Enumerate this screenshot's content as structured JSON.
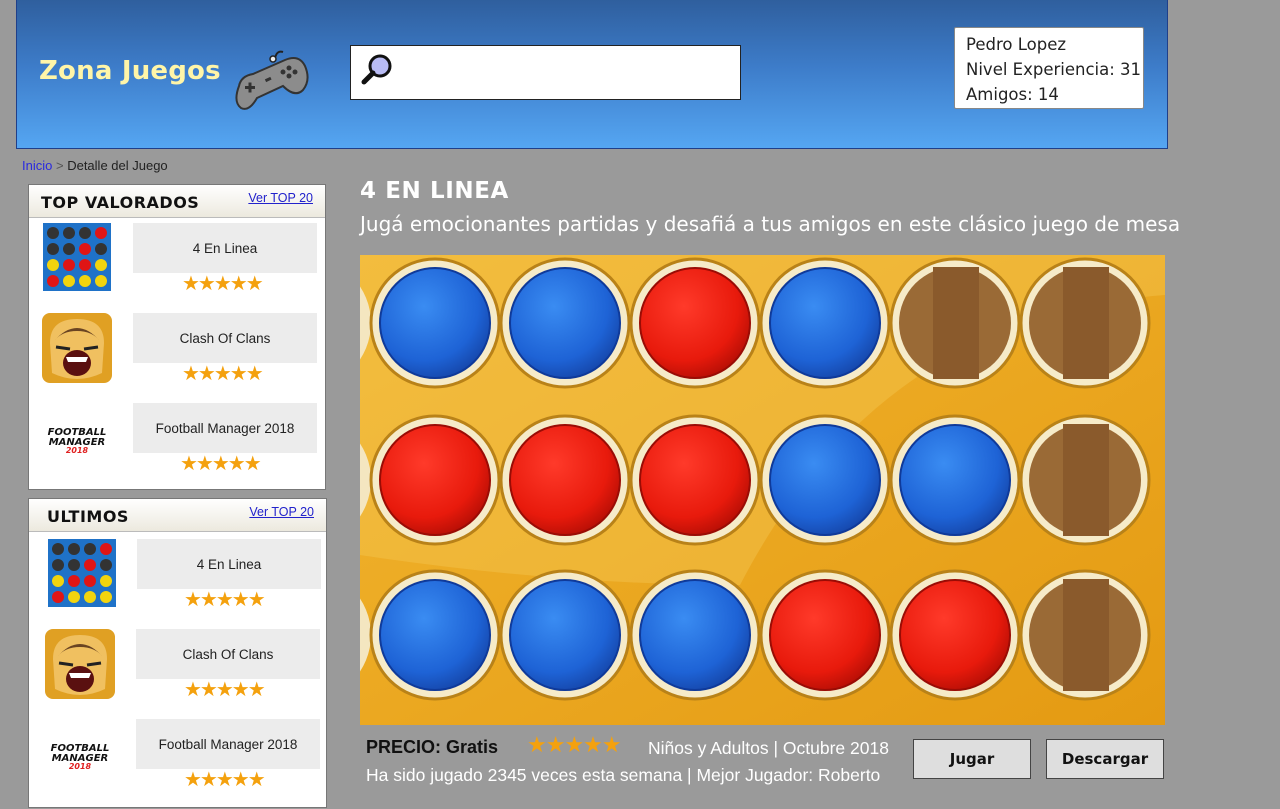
{
  "header": {
    "logo_text": "Zona Juegos",
    "search": {
      "value": "",
      "placeholder": ""
    },
    "user": {
      "name": "Pedro Lopez",
      "level": "Nivel Experiencia: 31",
      "friends": "Amigos: 14"
    }
  },
  "breadcrumb": {
    "home": "Inicio",
    "separator": ">",
    "current": "Detalle del Juego"
  },
  "sidebar": {
    "top_rated": {
      "title": "TOP VALORADOS",
      "link": "Ver TOP 20",
      "items": [
        {
          "name": "4 En Linea",
          "stars": "★★★★★",
          "icon": "connect-four-icon"
        },
        {
          "name": "Clash Of Clans",
          "stars": "★★★★★",
          "icon": "clash-of-clans-icon"
        },
        {
          "name": "Football Manager 2018",
          "stars": "★★★★★",
          "icon": "football-manager-icon"
        }
      ]
    },
    "latest": {
      "title": "ULTIMOS",
      "link": "Ver TOP 20",
      "items": [
        {
          "name": "4 En Linea",
          "stars": "★★★★★",
          "icon": "connect-four-icon"
        },
        {
          "name": "Clash Of Clans",
          "stars": "★★★★★",
          "icon": "clash-of-clans-icon"
        },
        {
          "name": "Football Manager 2018",
          "stars": "★★★★★",
          "icon": "football-manager-icon"
        }
      ]
    }
  },
  "game": {
    "title": "4 EN LINEA",
    "subtitle": "Jugá emocionantes partidas y desafiá a tus amigos en este clásico juego de mesa",
    "board": [
      [
        "blue",
        "blue",
        "red",
        "blue",
        "empty",
        "empty"
      ],
      [
        "red",
        "red",
        "red",
        "blue",
        "blue",
        "empty"
      ],
      [
        "blue",
        "blue",
        "blue",
        "red",
        "red",
        "empty"
      ]
    ],
    "price_label": "PRECIO: Gratis",
    "rating_stars": "★★★★★",
    "audience_date": "Niños y Adultos | Octubre 2018",
    "stats": "Ha sido jugado 2345 veces esta semana | Mejor Jugador: Roberto",
    "play_button": "Jugar",
    "download_button": "Descargar"
  },
  "colors": {
    "header_top": "#2f5f9e",
    "header_bottom": "#55a6f2",
    "logo": "#fff5a8",
    "star": "#f4a10e",
    "background": "#9a9a9a"
  }
}
